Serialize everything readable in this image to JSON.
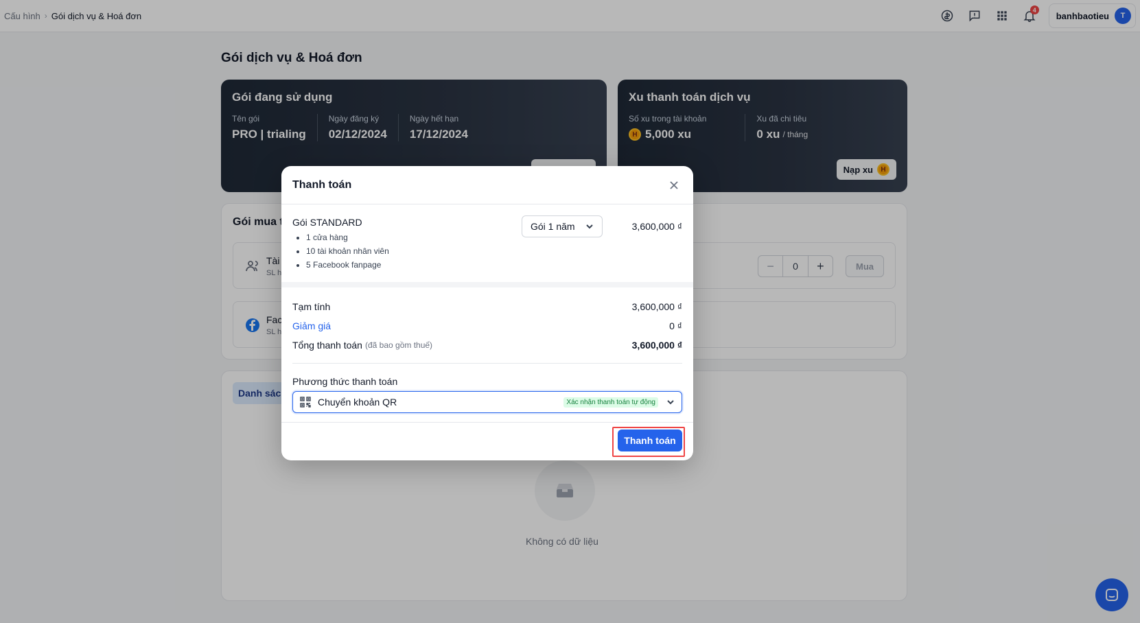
{
  "topbar": {
    "breadcrumb_root": "Cấu hình",
    "breadcrumb_current": "Gói dịch vụ & Hoá đơn",
    "notification_count": "4",
    "user_name": "banhbaotieu",
    "avatar_initial": "T"
  },
  "page": {
    "title": "Gói dịch vụ & Hoá đơn",
    "current_plan": {
      "title": "Gói đang sử dụng",
      "name_label": "Tên gói",
      "name_value": "PRO | trialing",
      "reg_label": "Ngày đăng ký",
      "reg_value": "02/12/2024",
      "exp_label": "Ngày hết hạn",
      "exp_value": "17/12/2024"
    },
    "coins": {
      "title": "Xu thanh toán dịch vụ",
      "balance_label": "Số xu trong tài khoản",
      "balance_value": "5,000 xu",
      "spent_label": "Xu đã chi tiêu",
      "spent_value": "0 xu",
      "spent_unit": "/ tháng",
      "topup_label": "Nạp xu"
    },
    "addons": {
      "title_partial": "Gói mua t",
      "rows": [
        {
          "title": "Tài",
          "sub": "SL h"
        },
        {
          "title": "Fac",
          "sub": "SL h"
        }
      ],
      "quantity": "0",
      "buy_label": "Mua"
    },
    "list": {
      "tab_label": "Danh sác",
      "empty_text": "Không có dữ liệu"
    }
  },
  "modal": {
    "title": "Thanh toán",
    "plan_name": "Gói STANDARD",
    "features": [
      "1 cửa hàng",
      "10 tài khoản nhân viên",
      "5 Facebook fanpage"
    ],
    "duration_selected": "Gói 1 năm",
    "plan_price": "3,600,000 ₫",
    "subtotal_label": "Tạm tính",
    "subtotal_value": "3,600,000 ₫",
    "discount_label": "Giảm giá",
    "discount_value": "0 ₫",
    "total_label": "Tổng thanh toán",
    "total_note": "(đã bao gồm thuế)",
    "total_value": "3,600,000 ₫",
    "payment_label": "Phương thức thanh toán",
    "payment_selected": "Chuyển khoản QR",
    "payment_tag": "Xác nhận thanh toán tự động",
    "pay_button": "Thanh toán"
  },
  "colors": {
    "primary": "#2563eb",
    "highlight": "#ef4444",
    "dark_card": "#1f2937"
  }
}
